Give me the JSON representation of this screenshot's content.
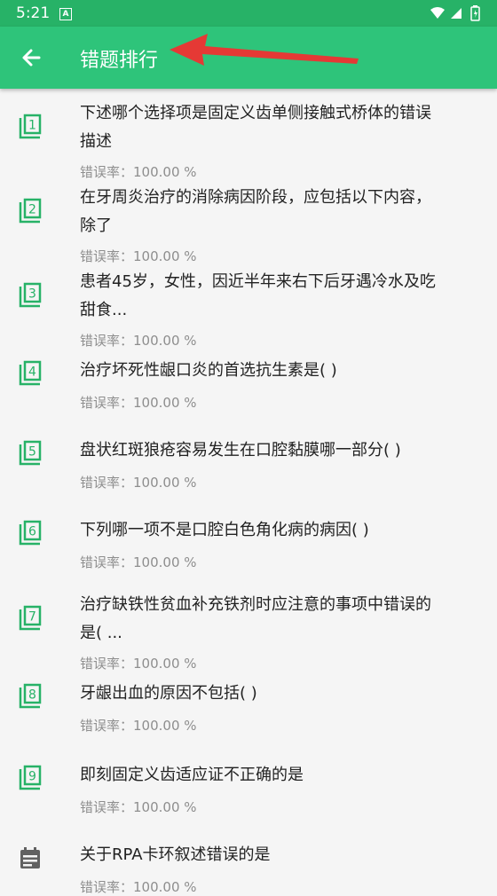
{
  "status_bar": {
    "time": "5:21",
    "notification_letter": "A"
  },
  "app_bar": {
    "title": "错题排行",
    "back_icon": "arrow-left-icon"
  },
  "colors": {
    "primary": "#2ec47a",
    "status": "#27b267",
    "icon": "#27b267",
    "text": "#222222",
    "subtext": "#8e8e8e"
  },
  "items": [
    {
      "rank": "1",
      "title_line1": "下述哪个选择项是固定义齿单侧接触式桥体的错误",
      "title_line2": "描述",
      "rate": "错误率：100.00 %"
    },
    {
      "rank": "2",
      "title_line1": "在牙周炎治疗的消除病因阶段，应包括以下内容，",
      "title_line2": "除了",
      "rate": "错误率：100.00 %"
    },
    {
      "rank": "3",
      "title_line1": "患者45岁，女性，因近半年来右下后牙遇冷水及吃",
      "title_line2": "甜食...",
      "rate": "错误率：100.00 %"
    },
    {
      "rank": "4",
      "title_line1": "治疗坏死性龈口炎的首选抗生素是(   )",
      "title_line2": "",
      "rate": "错误率：100.00 %"
    },
    {
      "rank": "5",
      "title_line1": "盘状红斑狼疮容易发生在口腔黏膜哪一部分(   )",
      "title_line2": "",
      "rate": "错误率：100.00 %"
    },
    {
      "rank": "6",
      "title_line1": "下列哪一项不是口腔白色角化病的病因(   )",
      "title_line2": "",
      "rate": "错误率：100.00 %"
    },
    {
      "rank": "7",
      "title_line1": "治疗缺铁性贫血补充铁剂时应注意的事项中错误的",
      "title_line2": "是( ...",
      "rate": "错误率：100.00 %"
    },
    {
      "rank": "8",
      "title_line1": "牙龈出血的原因不包括(   )",
      "title_line2": "",
      "rate": "错误率：100.00 %"
    },
    {
      "rank": "9",
      "title_line1": "即刻固定义齿适应证不正确的是",
      "title_line2": "",
      "rate": "错误率：100.00 %"
    },
    {
      "rank": "",
      "icon": "calendar-note-icon",
      "title_line1": "关于RPA卡环叙述错误的是",
      "title_line2": "",
      "rate": "错误率：100.00 %"
    }
  ]
}
